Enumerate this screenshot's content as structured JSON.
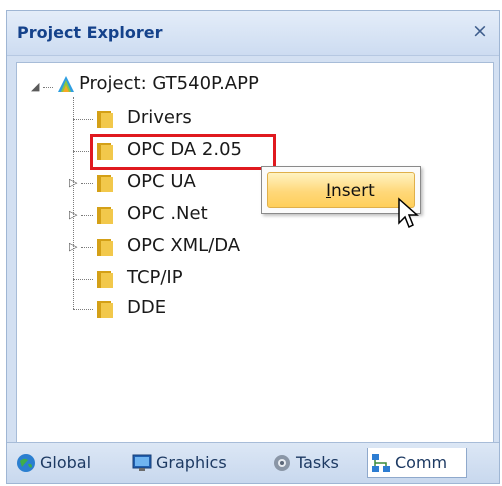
{
  "panel": {
    "title": "Project Explorer",
    "close_glyph": "×"
  },
  "tree": {
    "root": {
      "label": "Project: GT540P.APP",
      "icon": "project-icon",
      "expanded": true
    },
    "items": [
      {
        "label": "Drivers",
        "icon": "folder-icon",
        "expandable": false
      },
      {
        "label": "OPC DA 2.05",
        "icon": "folder-icon",
        "expandable": false,
        "highlighted": true
      },
      {
        "label": "OPC UA",
        "icon": "folder-icon",
        "expandable": true
      },
      {
        "label": "OPC .Net",
        "icon": "folder-icon",
        "expandable": true
      },
      {
        "label": "OPC XML/DA",
        "icon": "folder-icon",
        "expandable": true
      },
      {
        "label": "TCP/IP",
        "icon": "folder-icon",
        "expandable": false
      },
      {
        "label": "DDE",
        "icon": "folder-icon",
        "expandable": false
      }
    ],
    "expand_glyph": "▷",
    "collapse_glyph": "◢"
  },
  "context_menu": {
    "items": [
      {
        "label": "Insert",
        "accelerator": "I",
        "hovered": true
      }
    ]
  },
  "bottom_tabs": [
    {
      "label": "Global",
      "icon": "globe-icon",
      "active": false
    },
    {
      "label": "Graphics",
      "icon": "monitor-icon",
      "active": false
    },
    {
      "label": "Tasks",
      "icon": "gear-icon",
      "active": false
    },
    {
      "label": "Comm",
      "icon": "network-icon",
      "active": true
    }
  ],
  "colors": {
    "highlight": "#e0191f",
    "menu_hover": "#ffd87a",
    "title_text": "#15428b",
    "panel_bg": "#d3e0f2"
  }
}
